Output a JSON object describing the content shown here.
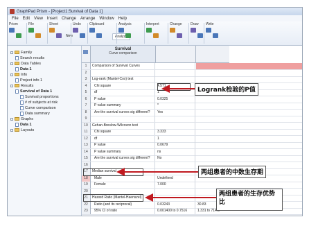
{
  "window": {
    "title": "GraphPad Prism - [Project1:Survival of Data 1]"
  },
  "menu": [
    "File",
    "Edit",
    "View",
    "Insert",
    "Change",
    "Arrange",
    "Window",
    "Help"
  ],
  "toolbar": {
    "groups": [
      "Prism",
      "File",
      "Sheet",
      "Undo",
      "Clipboard",
      "Analysis",
      "Interpret",
      "Change",
      "Draw",
      "Write"
    ],
    "analyze_label": "Analyze",
    "new_label": "New"
  },
  "nav": [
    {
      "label": "Family",
      "level": 0,
      "kind": "folder"
    },
    {
      "label": "Search results",
      "level": 1,
      "kind": "doc"
    },
    {
      "label": "Data Tables",
      "level": 0,
      "kind": "folder"
    },
    {
      "label": "Data 1",
      "level": 1,
      "kind": "doc",
      "bold": true
    },
    {
      "label": "Info",
      "level": 0,
      "kind": "folder"
    },
    {
      "label": "Project info 1",
      "level": 1,
      "kind": "doc"
    },
    {
      "label": "Results",
      "level": 0,
      "kind": "folder"
    },
    {
      "label": "Survival of Data 1",
      "level": 1,
      "kind": "doc",
      "bold": true
    },
    {
      "label": "Survival proportions",
      "level": 2,
      "kind": "doc"
    },
    {
      "label": "# of subjects at risk",
      "level": 2,
      "kind": "doc"
    },
    {
      "label": "Curve comparison",
      "level": 2,
      "kind": "doc"
    },
    {
      "label": "Data summary",
      "level": 2,
      "kind": "doc"
    },
    {
      "label": "Graphs",
      "level": 0,
      "kind": "folder"
    },
    {
      "label": "Data 1",
      "level": 1,
      "kind": "doc",
      "bold": true
    },
    {
      "label": "Layouts",
      "level": 0,
      "kind": "folder"
    }
  ],
  "sheet": {
    "header_title": "Survival",
    "header_subtitle": "Curve comparison",
    "rows": [
      {
        "n": "1",
        "label": "Comparison of Survival Curves",
        "v1": "",
        "v2": ""
      },
      {
        "n": "2",
        "label": "",
        "v1": "",
        "v2": ""
      },
      {
        "n": "3",
        "label": "Log-rank (Mantel-Cox) test",
        "v1": "",
        "v2": ""
      },
      {
        "n": "4",
        "label": "Chi square",
        "v1": "4.571",
        "v2": "",
        "indent": true
      },
      {
        "n": "5",
        "label": "df",
        "v1": "1",
        "v2": "",
        "indent": true
      },
      {
        "n": "6",
        "label": "P value",
        "v1": "0.0325",
        "v2": "",
        "indent": true
      },
      {
        "n": "7",
        "label": "P value summary",
        "v1": "*",
        "v2": "",
        "indent": true
      },
      {
        "n": "8",
        "label": "Are the survival curves sig different?",
        "v1": "Yes",
        "v2": "",
        "indent": true
      },
      {
        "n": "9",
        "label": "",
        "v1": "",
        "v2": ""
      },
      {
        "n": "10",
        "label": "Gehan-Breslow-Wilcoxon test",
        "v1": "",
        "v2": ""
      },
      {
        "n": "11",
        "label": "Chi square",
        "v1": "3.333",
        "v2": "",
        "indent": true
      },
      {
        "n": "12",
        "label": "df",
        "v1": "1",
        "v2": "",
        "indent": true
      },
      {
        "n": "13",
        "label": "P value",
        "v1": "0.0679",
        "v2": "",
        "indent": true
      },
      {
        "n": "14",
        "label": "P value summary",
        "v1": "ns",
        "v2": "",
        "indent": true
      },
      {
        "n": "15",
        "label": "Are the survival curves sig different?",
        "v1": "No",
        "v2": "",
        "indent": true
      },
      {
        "n": "16",
        "label": "",
        "v1": "",
        "v2": ""
      },
      {
        "n": "17",
        "label": "Median survival",
        "v1": "",
        "v2": ""
      },
      {
        "n": "18",
        "label": "Male",
        "v1": "Undefined",
        "v2": "",
        "indent": true,
        "highlight": true
      },
      {
        "n": "19",
        "label": "Female",
        "v1": "7.000",
        "v2": "",
        "indent": true
      },
      {
        "n": "20",
        "label": "",
        "v1": "",
        "v2": ""
      },
      {
        "n": "21",
        "label": "Hazard Ratio (Mantel-Haenszel)",
        "v1": "",
        "v2": ""
      },
      {
        "n": "22",
        "label": "Ratio (and its reciprocal)",
        "v1": "0.03243",
        "v2": "30.83",
        "indent": true
      },
      {
        "n": "23",
        "label": "95% CI of ratio",
        "v1": "0.001400 to 0.7516",
        "v2": "1.331 to 714.5",
        "indent": true
      }
    ]
  },
  "annotations": {
    "logrank": "Logrank检验的P值",
    "median": "两组患者的中数生存期",
    "hazard": "两组患者的生存优势比"
  },
  "colors": {
    "arrow": "#c0191f",
    "highlight_band": "#ef9f9f"
  }
}
